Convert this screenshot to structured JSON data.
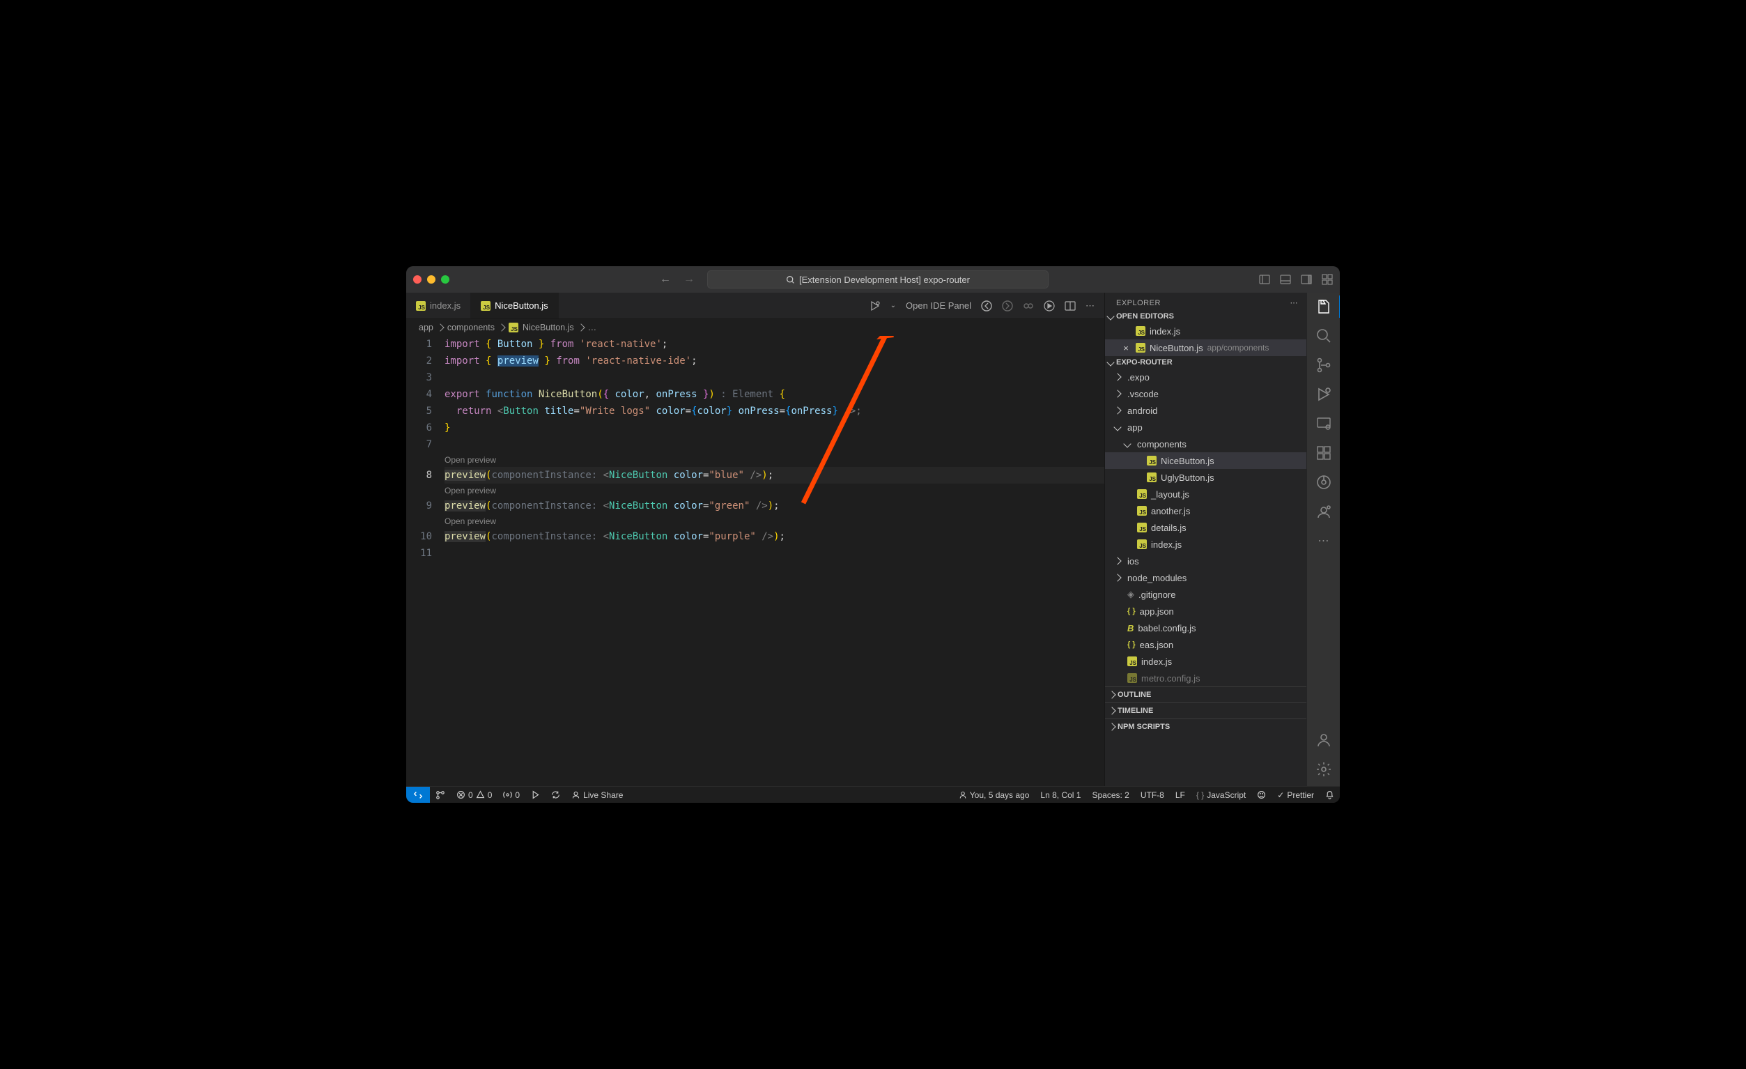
{
  "titlebar": {
    "search_text": "[Extension Development Host] expo-router"
  },
  "tabs": [
    {
      "label": "index.js",
      "active": false
    },
    {
      "label": "NiceButton.js",
      "active": true
    }
  ],
  "tab_actions": {
    "open_ide_panel": "Open IDE Panel"
  },
  "breadcrumb": {
    "parts": [
      "app",
      "components"
    ],
    "file": "NiceButton.js",
    "trail": "…"
  },
  "code": {
    "codelens": "Open preview",
    "lines": {
      "l1": {
        "a": "import",
        "b": " { ",
        "c": "Button",
        "d": " } ",
        "e": "from",
        "f": " ",
        "g": "'react-native'",
        "h": ";"
      },
      "l2": {
        "a": "import",
        "b": " { ",
        "c": "preview",
        "d": " } ",
        "e": "from",
        "f": " ",
        "g": "'react-native-ide'",
        "h": ";"
      },
      "l4": {
        "a": "export",
        "b": " ",
        "c": "function",
        "d": " ",
        "e": "NiceButton",
        "f": "(",
        "g": "{ ",
        "h": "color",
        "i": ", ",
        "j": "onPress",
        "k": " }",
        "l": ")",
        "m": " : ",
        "n": "Element",
        "o": " {",
        "p": ""
      },
      "l5": {
        "a": "  ",
        "b": "return",
        "c": " <",
        "d": "Button",
        "e": " ",
        "f": "title",
        "g": "=",
        "h": "\"Write logs\"",
        "i": " ",
        "j": "color",
        "k": "=",
        "l": "{",
        "m": "color",
        "n": "}",
        "o": " ",
        "p": "onPress",
        "q": "=",
        "r": "{",
        "s": "onPress",
        "t": "}",
        "u": " />;",
        "v": ""
      },
      "l6": {
        "a": "}"
      },
      "l8": {
        "a": "preview",
        "b": "(",
        "c": "componentInstance: ",
        "d": "<",
        "e": "NiceButton",
        "f": " ",
        "g": "color",
        "h": "=",
        "i": "\"blue\"",
        "j": " />",
        "k": ")",
        "l": ";"
      },
      "l9": {
        "a": "preview",
        "b": "(",
        "c": "componentInstance: ",
        "d": "<",
        "e": "NiceButton",
        "f": " ",
        "g": "color",
        "h": "=",
        "i": "\"green\"",
        "j": " />",
        "k": ")",
        "l": ";"
      },
      "l10": {
        "a": "preview",
        "b": "(",
        "c": "componentInstance: ",
        "d": "<",
        "e": "NiceButton",
        "f": " ",
        "g": "color",
        "h": "=",
        "i": "\"purple\"",
        "j": " />",
        "k": ")",
        "l": ";"
      }
    },
    "line_numbers": [
      "1",
      "2",
      "3",
      "4",
      "5",
      "6",
      "7",
      "8",
      "9",
      "10",
      "11"
    ]
  },
  "explorer": {
    "title": "EXPLORER",
    "open_editors": {
      "label": "OPEN EDITORS",
      "items": [
        {
          "name": "index.js"
        },
        {
          "name": "NiceButton.js",
          "path": "app/components",
          "active": true
        }
      ]
    },
    "project": {
      "label": "EXPO-ROUTER",
      "tree": [
        {
          "name": ".expo",
          "type": "folder",
          "depth": 0
        },
        {
          "name": ".vscode",
          "type": "folder",
          "depth": 0
        },
        {
          "name": "android",
          "type": "folder",
          "depth": 0
        },
        {
          "name": "app",
          "type": "folder",
          "depth": 0,
          "open": true
        },
        {
          "name": "components",
          "type": "folder",
          "depth": 1,
          "open": true
        },
        {
          "name": "NiceButton.js",
          "type": "js",
          "depth": 2,
          "selected": true
        },
        {
          "name": "UglyButton.js",
          "type": "js",
          "depth": 2
        },
        {
          "name": "_layout.js",
          "type": "js",
          "depth": 1
        },
        {
          "name": "another.js",
          "type": "js",
          "depth": 1
        },
        {
          "name": "details.js",
          "type": "js",
          "depth": 1
        },
        {
          "name": "index.js",
          "type": "js",
          "depth": 1
        },
        {
          "name": "ios",
          "type": "folder",
          "depth": 0
        },
        {
          "name": "node_modules",
          "type": "folder",
          "depth": 0
        },
        {
          "name": ".gitignore",
          "type": "git",
          "depth": 0
        },
        {
          "name": "app.json",
          "type": "json",
          "depth": 0
        },
        {
          "name": "babel.config.js",
          "type": "babel",
          "depth": 0
        },
        {
          "name": "eas.json",
          "type": "json",
          "depth": 0
        },
        {
          "name": "index.js",
          "type": "js",
          "depth": 0
        },
        {
          "name": "metro.config.js",
          "type": "js",
          "depth": 0,
          "cut": true
        }
      ]
    },
    "sections": {
      "outline": "OUTLINE",
      "timeline": "TIMELINE",
      "npm": "NPM SCRIPTS"
    }
  },
  "status": {
    "errors": "0",
    "warnings": "0",
    "ports": "0",
    "live_share": "Live Share",
    "blame": "You, 5 days ago",
    "cursor": "Ln 8, Col 1",
    "spaces": "Spaces: 2",
    "encoding": "UTF-8",
    "eol": "LF",
    "lang": "JavaScript",
    "prettier": "Prettier"
  }
}
